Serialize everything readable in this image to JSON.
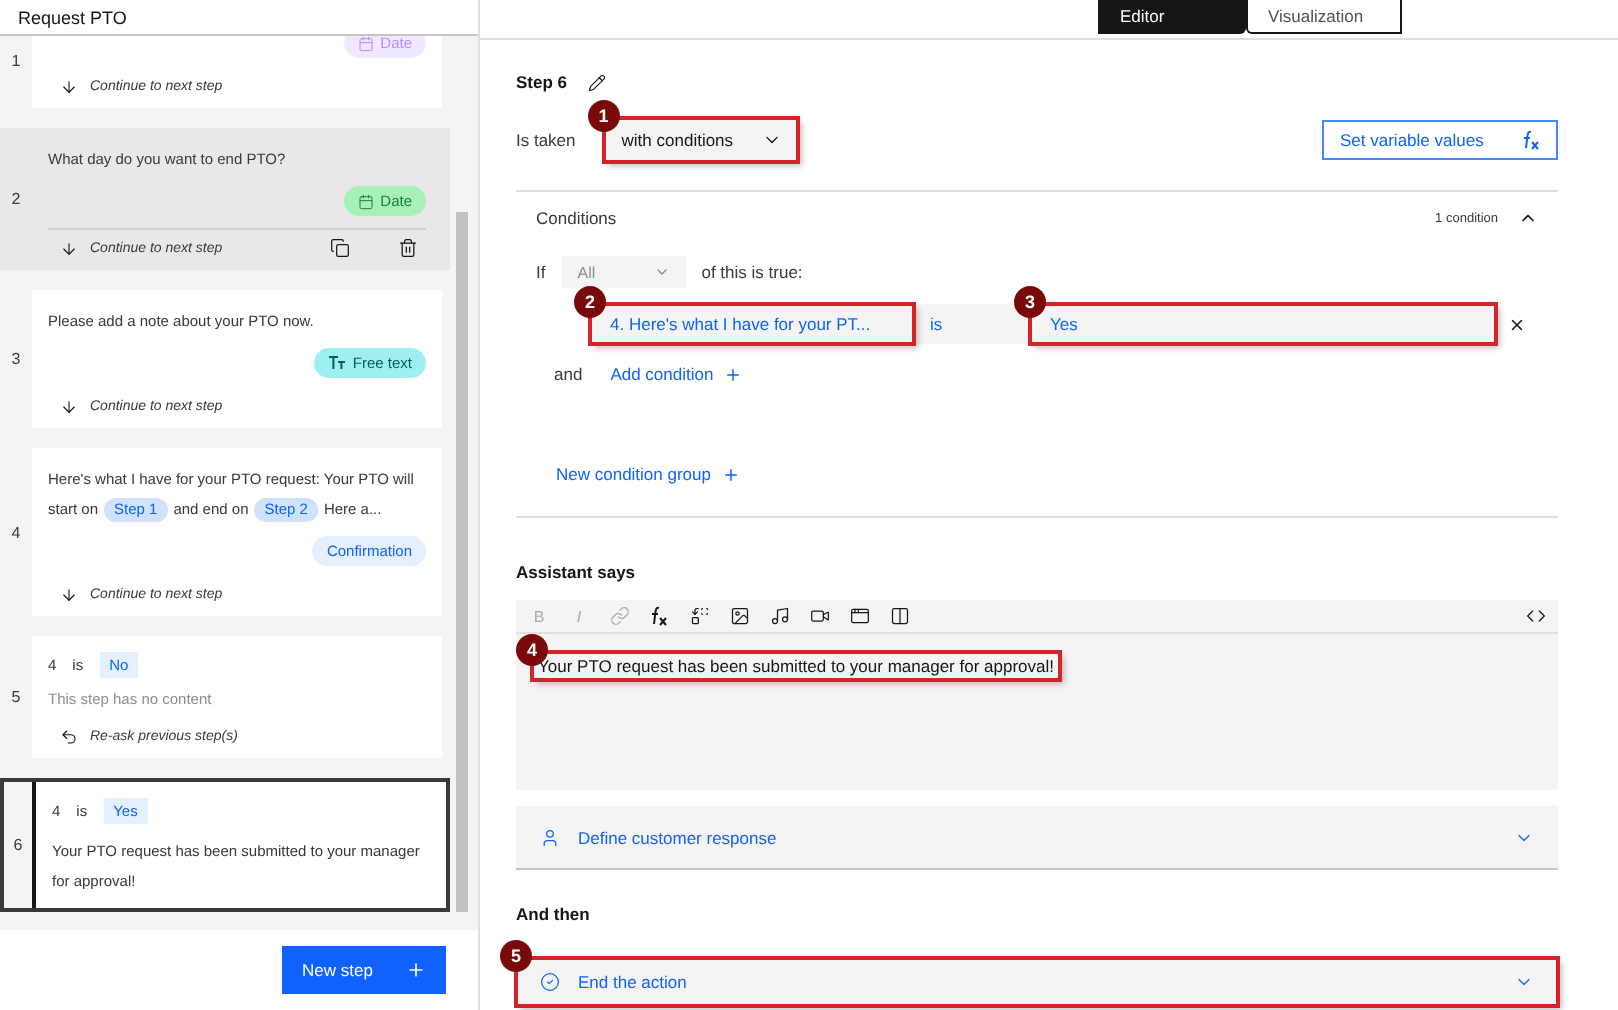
{
  "title": "Request PTO",
  "view_tabs": [
    {
      "label": "Editor",
      "selected": true
    },
    {
      "label": "Visualization",
      "selected": false
    }
  ],
  "steps": [
    {
      "number": "1",
      "selected": false,
      "hovered": false,
      "tag": {
        "kind": "date",
        "label": "Date"
      },
      "next": {
        "kind": "continue",
        "label": "Continue to next step"
      }
    },
    {
      "number": "2",
      "selected": false,
      "hovered": true,
      "prompt": [
        {
          "kind": "text",
          "text": "What day do you want to end PTO?"
        }
      ],
      "tag": {
        "kind": "date",
        "label": "Date"
      },
      "next": {
        "kind": "continue",
        "label": "Continue to next step"
      }
    },
    {
      "number": "3",
      "selected": false,
      "hovered": false,
      "prompt": [
        {
          "kind": "text",
          "text": "Please add a note about your PTO now."
        }
      ],
      "tag": {
        "kind": "free_text",
        "label": "Free text"
      },
      "next": {
        "kind": "continue",
        "label": "Continue to next step"
      }
    },
    {
      "number": "4",
      "selected": false,
      "hovered": false,
      "prompt": [
        {
          "kind": "text",
          "text": "Here's what I have for your PTO request: Your PTO will start on"
        },
        {
          "kind": "chip",
          "text": "Step 1"
        },
        {
          "kind": "text",
          "text": "and end on"
        },
        {
          "kind": "chip",
          "text": "Step 2"
        },
        {
          "kind": "text",
          "text": "Here a..."
        }
      ],
      "tag": {
        "kind": "confirmation",
        "label": "Confirmation"
      },
      "next": {
        "kind": "continue",
        "label": "Continue to next step"
      }
    },
    {
      "number": "5",
      "selected": false,
      "hovered": false,
      "condition": {
        "variable": "4",
        "operator": "is",
        "value": "No"
      },
      "prompt": [
        {
          "kind": "empty",
          "text": "This step has no content"
        }
      ],
      "next": {
        "kind": "reask",
        "label": "Re-ask previous step(s)"
      }
    },
    {
      "number": "6",
      "selected": true,
      "hovered": false,
      "condition": {
        "variable": "4",
        "operator": "is",
        "value": "Yes"
      },
      "prompt": [
        {
          "kind": "text",
          "text": "Your PTO request has been submitted to your manager for approval!"
        }
      ]
    }
  ],
  "new_step_button": "New step",
  "editor": {
    "step_title": "Step 6",
    "is_taken": {
      "label": "Is taken",
      "value": "with conditions",
      "callout": "1"
    },
    "set_variable_button": "Set variable values",
    "conditions": {
      "title": "Conditions",
      "count": "1 condition",
      "expanded": true,
      "if_label": "If",
      "match": {
        "value": "All",
        "disabled": true
      },
      "match_suffix": "of this is true:",
      "rows": [
        {
          "variable": "4. Here's what I have for your PT...",
          "variable_callout": "2",
          "operator": "is",
          "value": "Yes",
          "value_callout": "3"
        }
      ],
      "and_label": "and",
      "add_condition": "Add condition",
      "new_group": "New condition group"
    },
    "assistant_says": {
      "label": "Assistant says",
      "toolbar": [
        {
          "kind": "bold",
          "label": "B",
          "disabled": true
        },
        {
          "kind": "italic",
          "label": "I",
          "disabled": true
        },
        {
          "kind": "link",
          "disabled": true
        },
        {
          "kind": "function",
          "disabled": false
        },
        {
          "kind": "variable",
          "disabled": false
        },
        {
          "kind": "image",
          "disabled": false
        },
        {
          "kind": "audio",
          "disabled": false
        },
        {
          "kind": "video",
          "disabled": false
        },
        {
          "kind": "iframe",
          "disabled": false
        },
        {
          "kind": "columns",
          "disabled": false
        },
        {
          "kind": "code",
          "disabled": false
        }
      ],
      "message": "Your PTO request has been submitted to your manager for approval!",
      "callout": "4"
    },
    "customer_response": "Define customer response",
    "and_then": {
      "label": "And then",
      "action": "End the action",
      "callout": "5"
    }
  }
}
